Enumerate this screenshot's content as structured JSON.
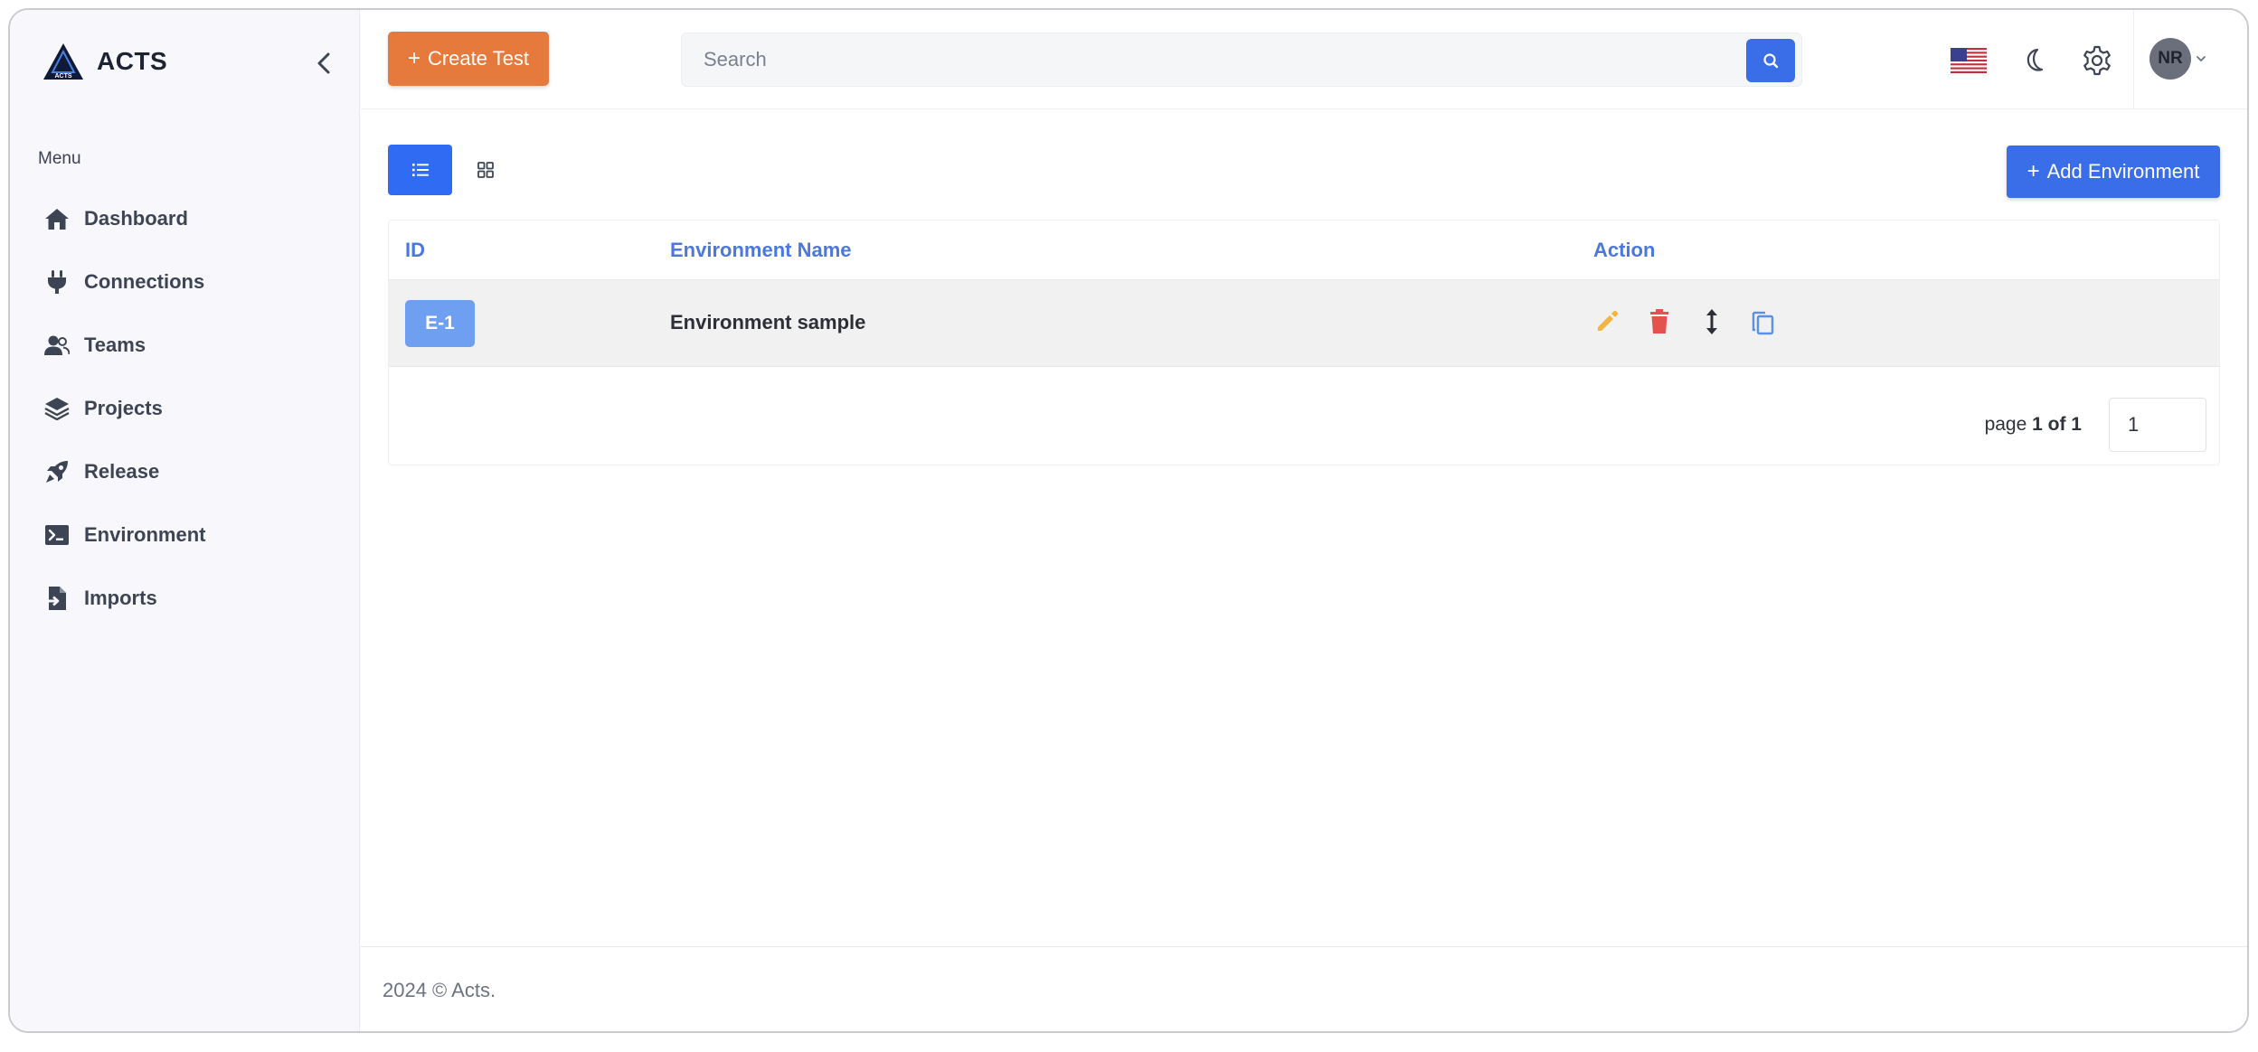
{
  "brand": {
    "name": "ACTS",
    "logo_text": "ACTS"
  },
  "sidebar": {
    "menu_title": "Menu",
    "items": [
      {
        "label": "Dashboard",
        "icon": "home-icon"
      },
      {
        "label": "Connections",
        "icon": "plug-icon"
      },
      {
        "label": "Teams",
        "icon": "users-icon"
      },
      {
        "label": "Projects",
        "icon": "layers-icon"
      },
      {
        "label": "Release",
        "icon": "rocket-icon"
      },
      {
        "label": "Environment",
        "icon": "terminal-icon"
      },
      {
        "label": "Imports",
        "icon": "file-import-icon"
      }
    ]
  },
  "header": {
    "create_label": "Create Test",
    "search_placeholder": "Search",
    "avatar_initials": "NR",
    "language_flag": "us-flag-icon"
  },
  "toolbar": {
    "add_label": "Add Environment"
  },
  "table": {
    "columns": [
      "ID",
      "Environment Name",
      "Action"
    ],
    "rows": [
      {
        "id": "E-1",
        "name": "Environment sample"
      }
    ],
    "actions": [
      "edit-icon",
      "delete-icon",
      "move-icon",
      "copy-icon"
    ]
  },
  "pagination": {
    "prefix": "page",
    "current_of_total": "1 of 1",
    "input_value": "1"
  },
  "footer": {
    "text": "2024 © Acts."
  },
  "colors": {
    "primary": "#3a6ee8",
    "accent": "#e67a3c",
    "badge": "#6f9ff0",
    "edit": "#f2b640",
    "delete": "#e4524e",
    "copy": "#5b8fe8"
  }
}
